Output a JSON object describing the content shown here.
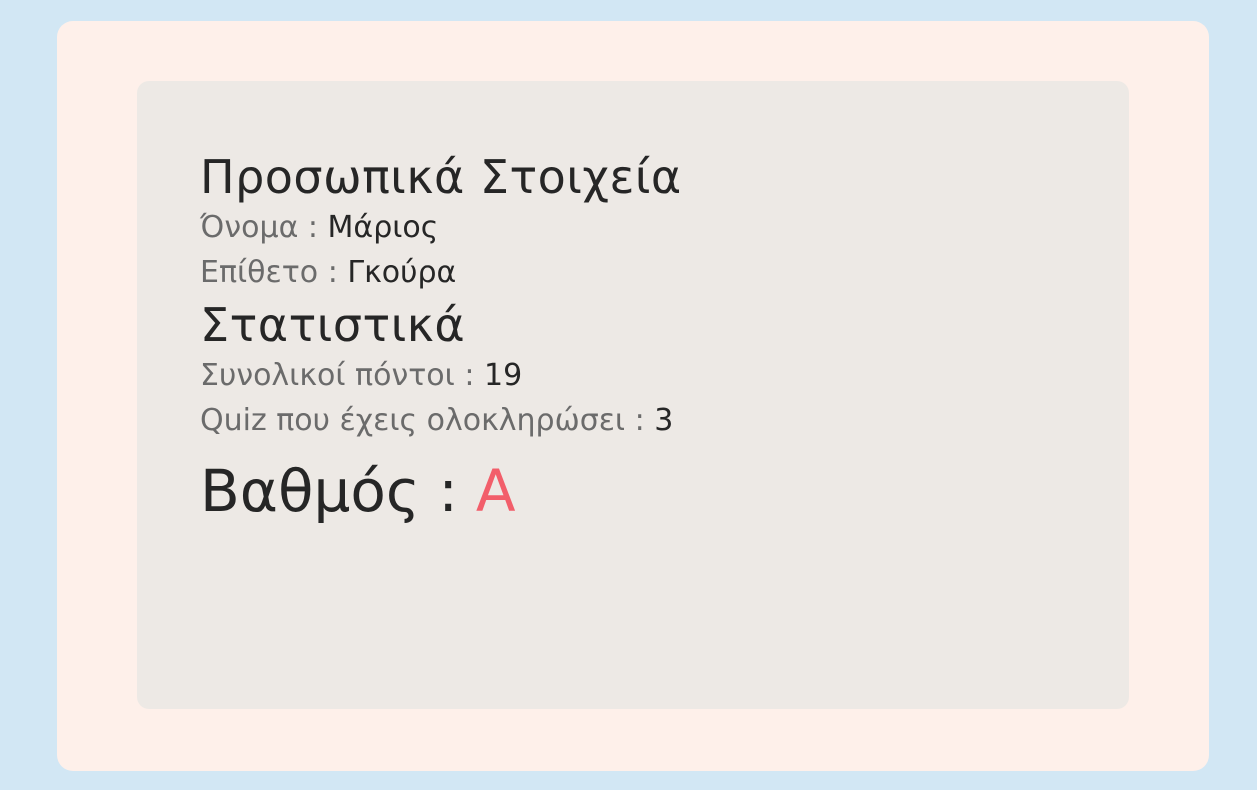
{
  "personal": {
    "title": "Προσωπικά Στοιχεία",
    "first_name_label": "Όνομα :",
    "first_name_value": "Μάριος",
    "last_name_label": "Επίθετο :",
    "last_name_value": "Γκούρα"
  },
  "stats": {
    "title": "Στατιστικά",
    "total_points_label": "Συνολικοί πόντοι :",
    "total_points_value": "19",
    "quizzes_label": "Quiz που έχεις ολοκληρώσει :",
    "quizzes_value": "3"
  },
  "grade": {
    "label": "Βαθμός :",
    "value": "A"
  },
  "colors": {
    "page_background": "#d2e7f4",
    "outer_card": "#fef0ea",
    "inner_card": "#ede9e5",
    "grade_accent": "#f25e6a"
  }
}
